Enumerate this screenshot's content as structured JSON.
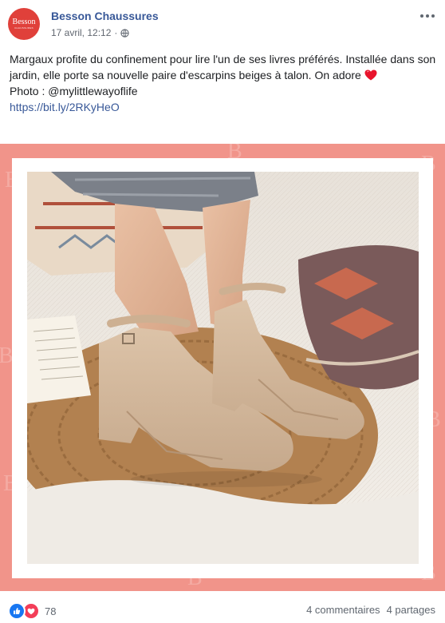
{
  "post": {
    "page_name": "Besson Chaussures",
    "avatar_logo": "Besson",
    "avatar_sub": "CHAUSSURES",
    "timestamp": "17 avril, 12:12",
    "separator": "·",
    "privacy_icon": "globe-icon",
    "more_icon": "more-options-icon"
  },
  "body": {
    "line1": "Margaux profite du confinement pour lire l'un de ses livres préférés. Installée dans son jardin, elle porte sa nouvelle paire d'escarpins beiges à talon. On adore",
    "emoji": "heart-emoji",
    "photo_credit": "Photo : @mylittlewayoflife",
    "link": "https://bit.ly/2RKyHeO"
  },
  "footer": {
    "reaction_icons": [
      "like-icon",
      "love-icon"
    ],
    "reaction_count": "78",
    "comments": "4 commentaires",
    "shares": "4 partages"
  },
  "colors": {
    "brand": "#e0403a",
    "frame": "#f1948a",
    "link": "#385898",
    "like": "#1877f2",
    "love": "#f33e58"
  }
}
